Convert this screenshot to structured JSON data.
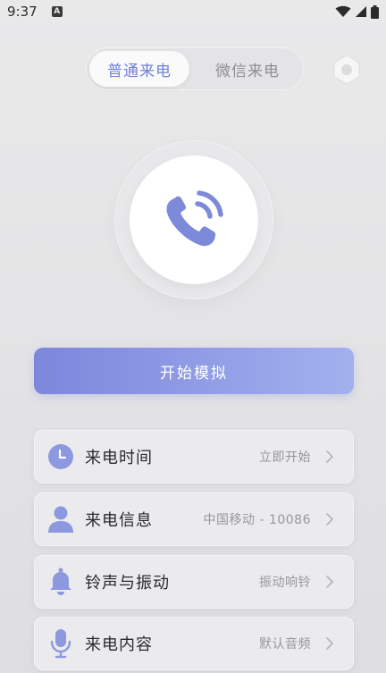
{
  "status_bar": {
    "time": "9:37",
    "notification_glyph": "A",
    "icons": [
      "wifi-icon",
      "signal-icon",
      "battery-icon"
    ]
  },
  "tabs": [
    {
      "label": "普通来电",
      "active": true
    },
    {
      "label": "微信来电",
      "active": false
    }
  ],
  "main": {
    "start_button_label": "开始模拟"
  },
  "settings": [
    {
      "label": "来电时间",
      "value": "立即开始",
      "icon": "clock-icon"
    },
    {
      "label": "来电信息",
      "value": "中国移动 - 10086",
      "icon": "person-icon"
    },
    {
      "label": "铃声与振动",
      "value": "振动响铃",
      "icon": "bell-icon"
    },
    {
      "label": "来电内容",
      "value": "默认音频",
      "icon": "microphone-icon"
    }
  ],
  "colors": {
    "accent": "#7280d8",
    "button_gradient_start": "#7c87dc",
    "button_gradient_end": "#a3b0ee",
    "icon_color": "#7c8ad9",
    "background": "#e6e6e8"
  }
}
